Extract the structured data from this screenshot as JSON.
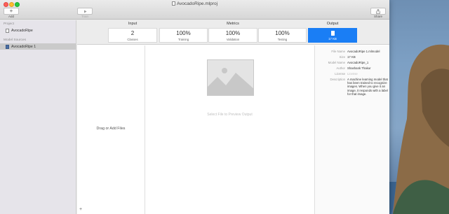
{
  "window": {
    "title": "AvocadoRipe.mlproj"
  },
  "toolbar": {
    "add_label": "Add",
    "train_label": "Train",
    "share_label": "Share"
  },
  "sidebar": {
    "project_header": "Project",
    "project_item": "AvocadoRipe",
    "sources_header": "Model Sources",
    "source_item": "AvocadoRipe 1"
  },
  "stats": {
    "input": {
      "title": "Input",
      "value": "2",
      "label": "Classes"
    },
    "metrics": {
      "title": "Metrics",
      "cards": [
        {
          "value": "100%",
          "label": "Training"
        },
        {
          "value": "100%",
          "label": "Validation"
        },
        {
          "value": "100%",
          "label": "Testing"
        }
      ]
    },
    "output": {
      "title": "Output",
      "label": "17 KB"
    }
  },
  "main": {
    "drag_text": "Drag or Add Files",
    "preview_hint": "Select File to Preview Output"
  },
  "metadata": {
    "rows": [
      {
        "key": "File Name",
        "value": "AvocadoRipe 1.mlmodel"
      },
      {
        "key": "Size",
        "value": "17 KB"
      },
      {
        "key": "Model Name",
        "value": "AvocadoRipe_1"
      },
      {
        "key": "Author",
        "value": "Shashank Thakur"
      },
      {
        "key": "License",
        "value": "License"
      },
      {
        "key": "Description",
        "value": "A machine learning model that has been trained to recognize images. When you give it an image, it responds with a label for that image."
      }
    ]
  },
  "colors": {
    "accent": "#1a7ef5",
    "sidebar_selected": "#cacaca"
  }
}
